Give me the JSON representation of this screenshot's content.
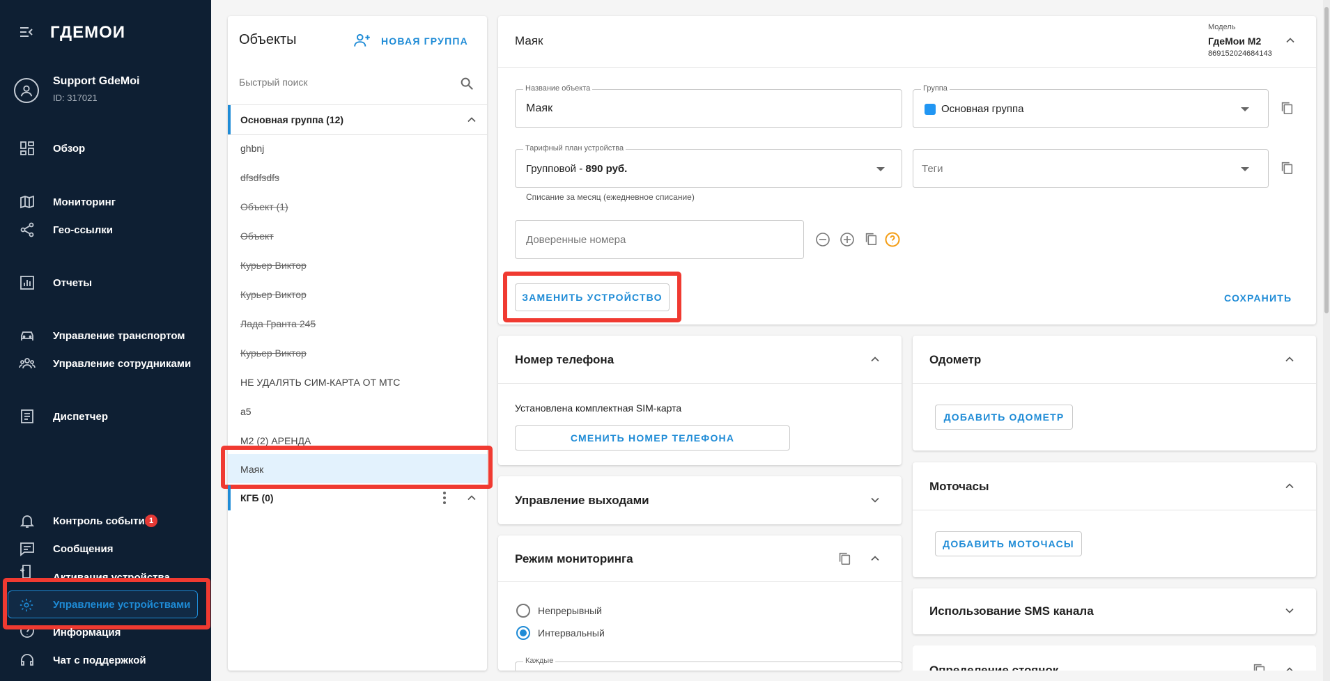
{
  "app": {
    "logo": "ГДЕМОИ"
  },
  "user": {
    "name": "Support GdeMoi",
    "id": "ID: 317021"
  },
  "menu": [
    {
      "label": "Обзор",
      "icon": "dashboard-icon"
    },
    {
      "label": "Мониторинг",
      "icon": "map-icon"
    },
    {
      "label": "Гео-ссылки",
      "icon": "share-icon"
    },
    {
      "label": "Отчеты",
      "icon": "bar-chart-icon"
    },
    {
      "label": "Управление транспортом",
      "icon": "car-icon"
    },
    {
      "label": "Управление сотрудниками",
      "icon": "people-icon"
    },
    {
      "label": "Диспетчер",
      "icon": "document-icon"
    },
    {
      "label": "Контроль событий",
      "icon": "bell-icon",
      "badge": "1"
    },
    {
      "label": "Сообщения",
      "icon": "chat-icon"
    },
    {
      "label": "Активация устройства",
      "icon": "add-device-icon"
    },
    {
      "label": "Управление устройствами",
      "icon": "gear-icon"
    },
    {
      "label": "Информация",
      "icon": "help-icon"
    },
    {
      "label": "Чат с поддержкой",
      "icon": "support-icon"
    }
  ],
  "objects": {
    "title": "Объекты",
    "new_group": "НОВАЯ ГРУППА",
    "search_placeholder": "Быстрый поиск",
    "group_main": {
      "name": "Основная группа",
      "count": "(12)"
    },
    "items": [
      {
        "name": "ghbnj",
        "struck": false
      },
      {
        "name": "dfsdfsdfs",
        "struck": true
      },
      {
        "name": "Объект (1)",
        "struck": true
      },
      {
        "name": "Объект",
        "struck": true
      },
      {
        "name": "Курьер Виктор",
        "struck": true
      },
      {
        "name": "Курьер Виктор",
        "struck": true
      },
      {
        "name": "Лада Гранта 245",
        "struck": true
      },
      {
        "name": "Курьер Виктор",
        "struck": true
      },
      {
        "name": "НЕ УДАЛЯТЬ СИМ-КАРТА ОТ МТС",
        "struck": false
      },
      {
        "name": "a5",
        "struck": false
      },
      {
        "name": "M2 (2) АРЕНДА",
        "struck": false
      },
      {
        "name": "Маяк",
        "struck": false
      }
    ],
    "group_kgb": {
      "name": "КГБ",
      "count": "(0)"
    }
  },
  "device": {
    "title": "Маяк",
    "model_label": "Модель",
    "model_name": "ГдеМои М2",
    "model_imei": "869152024684143",
    "name_label": "Название объекта",
    "name_value": "Маяк",
    "group_label": "Группа",
    "group_value": "Основная группа",
    "group_color": "#2196f3",
    "tariff_label": "Тарифный план устройства",
    "tariff_value_prefix": "Групповой - ",
    "tariff_value_price": "890 руб.",
    "tariff_hint": "Списание за месяц (ежедневное списание)",
    "tags_placeholder": "Теги",
    "trusted_placeholder": "Доверенные номера",
    "replace_btn": "ЗАМЕНИТЬ УСТРОЙСТВО",
    "save_btn": "СОХРАНИТЬ"
  },
  "phone": {
    "title": "Номер телефона",
    "text": "Установлена комплектная SIM-карта",
    "btn": "СМЕНИТЬ НОМЕР ТЕЛЕФОНА"
  },
  "outputs": {
    "title": "Управление выходами"
  },
  "monitoring": {
    "title": "Режим мониторинга",
    "options": [
      "Непрерывный",
      "Интервальный"
    ],
    "selected": 1,
    "every_label": "Каждые"
  },
  "odometer": {
    "title": "Одометр",
    "btn": "ДОБАВИТЬ ОДОМЕТР"
  },
  "motohours": {
    "title": "Моточасы",
    "btn": "ДОБАВИТЬ МОТОЧАСЫ"
  },
  "sms": {
    "title": "Использование SMS канала"
  },
  "parking": {
    "title": "Определение стоянок"
  },
  "colors": {
    "accent": "#1e8bd6",
    "highlight": "#f03a31",
    "sidebar": "#0e1f33"
  }
}
